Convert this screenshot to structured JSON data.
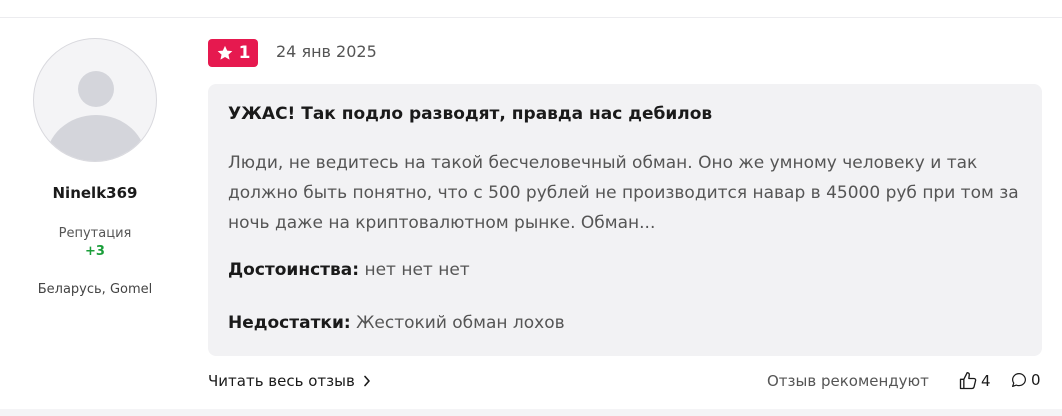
{
  "review": {
    "rating": "1",
    "date": "24 янв 2025",
    "title": "УЖАС! Так подло разводят, правда нас дебилов",
    "text": "Люди, не ведитесь на такой бесчеловечный обман. Оно же умному человеку и так должно быть понятно, что с 500 рублей не производится навар в 45000 руб при том за ночь даже на криптовалютном рынке. Обман...",
    "pros_label": "Достоинства:",
    "pros_value": "нет нет нет",
    "cons_label": "Недостатки:",
    "cons_value": "Жестокий обман лохов"
  },
  "author": {
    "name": "Ninelk369",
    "reputation_label": "Репутация",
    "reputation_value": "+3",
    "location": "Беларусь, Gomel"
  },
  "footer": {
    "read_full_label": "Читать весь отзыв",
    "recommend_label": "Отзыв рекомендуют",
    "likes_count": "4",
    "comments_count": "0"
  },
  "colors": {
    "accent": "#e6194f",
    "reputation_positive": "#1a9e3a",
    "body_background": "#f2f2f4"
  },
  "icons": [
    "star-icon",
    "chevron-right-icon",
    "thumbs-up-icon",
    "comment-icon",
    "avatar-placeholder-icon"
  ]
}
